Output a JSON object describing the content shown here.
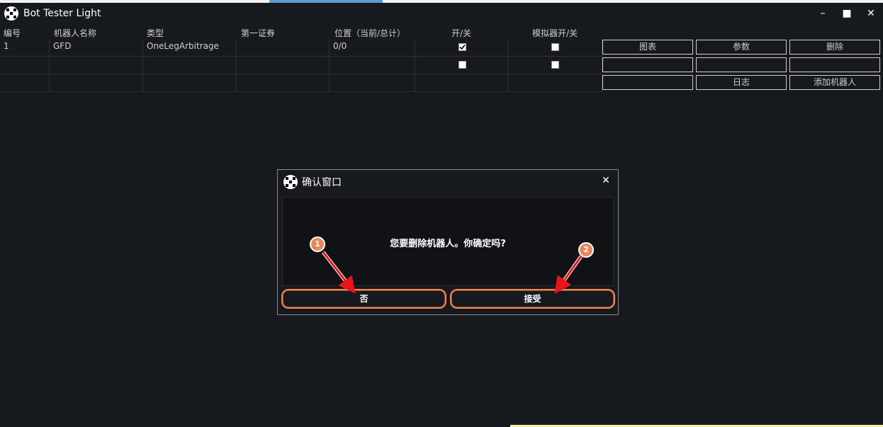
{
  "window": {
    "title": "Bot Tester Light",
    "minimize_label": "–",
    "maximize_label": "■",
    "close_label": "✕",
    "logo_icon": "checker-logo-icon"
  },
  "table": {
    "columns": [
      "编号",
      "机器人名称",
      "类型",
      "第一证券",
      "位置（当前/总计）",
      "开/关",
      "模拟器开/关"
    ],
    "rows": [
      {
        "id": "1",
        "name": "GFD",
        "type": "OneLegArbitrage",
        "security": "",
        "position": "0/0",
        "enabled": true,
        "emulator": false
      },
      {
        "id": "",
        "name": "",
        "type": "",
        "security": "",
        "position": "",
        "enabled": false,
        "emulator": false
      },
      {
        "id": "",
        "name": "",
        "type": "",
        "security": "",
        "position": "",
        "enabled": null,
        "emulator": null
      }
    ]
  },
  "actions": {
    "chart": "图表",
    "params": "参数",
    "delete": "删除",
    "log": "日志",
    "add_robot": "添加机器人"
  },
  "dialog": {
    "title": "确认窗口",
    "close_label": "✕",
    "message": "您要删除机器人。你确定吗?",
    "no_label": "否",
    "accept_label": "接受"
  },
  "callouts": [
    "1",
    "2"
  ],
  "colors": {
    "background": "#16191d",
    "highlight": "#e9875a",
    "arrow": "#e8141a"
  }
}
